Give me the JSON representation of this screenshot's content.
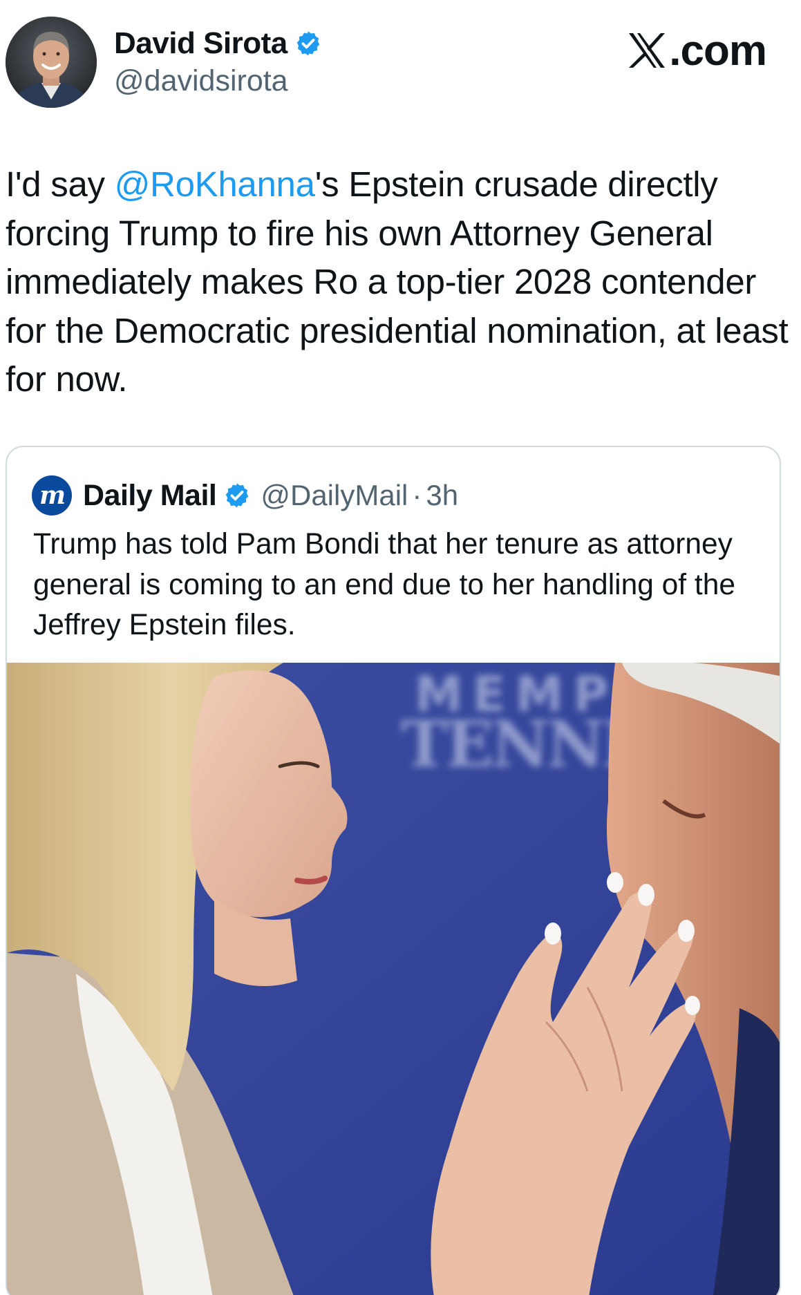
{
  "author": {
    "name": "David Sirota",
    "handle": "@davidsirota",
    "avatar_icon": "avatar-photo",
    "verified_icon": "verified-badge-icon",
    "verified_color": "#1d9bf0"
  },
  "site_brand": {
    "logo_icon": "x-logo-icon",
    "suffix": ".com"
  },
  "tweet": {
    "text_before": "I'd say ",
    "mention": "@RoKhanna",
    "text_after": "'s Epstein crusade directly forcing Trump to fire his own Attorney General immediately makes Ro a top-tier 2028 contender for the Democratic presidential nomination, at least for now.",
    "mention_color": "#1d9bf0"
  },
  "quote": {
    "logo_letter": "m",
    "logo_color": "#0a4a9c",
    "name": "Daily Mail",
    "handle": "@DailyMail",
    "separator": "·",
    "time": "3h",
    "text": "Trump has told Pam Bondi that her tenure as attorney general is coming to an end due to her handling of the Jeffrey Epstein files.",
    "image": {
      "backdrop_line1": "MEMP",
      "backdrop_line2": "TENNES"
    }
  }
}
